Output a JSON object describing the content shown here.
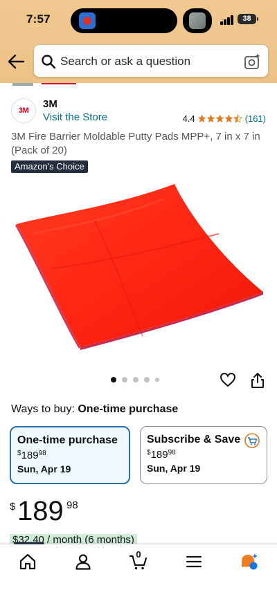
{
  "status_bar": {
    "time": "7:57",
    "battery": "38"
  },
  "search": {
    "placeholder": "Search or ask a question"
  },
  "brand": {
    "logo": "3M",
    "name": "3M",
    "visit_store": "Visit the Store"
  },
  "rating": {
    "value": "4.4",
    "stars": 4.4,
    "count": "(161)"
  },
  "product": {
    "title": "3M Fire Barrier Moldable Putty Pads MPP+, 7 in x 7 in (Pack of 20)",
    "badge": "Amazon's Choice",
    "image_icon": "red-putty-pad-image",
    "image_color": "#ff2a12"
  },
  "carousel": {
    "total": 5,
    "active": 1
  },
  "ways_to_buy": {
    "label": "Ways to buy:",
    "value": "One-time purchase"
  },
  "options": [
    {
      "title": "One-time purchase",
      "currency": "$",
      "whole": "189",
      "fraction": "98",
      "date": "Sun, Apr 19",
      "selected": true
    },
    {
      "title": "Subscribe & Save",
      "currency": "$",
      "whole": "189",
      "fraction": "98",
      "date": "Sun, Apr 19",
      "selected": false
    }
  ],
  "price": {
    "currency": "$",
    "whole": "189",
    "fraction": "98"
  },
  "peek": {
    "text": "$32.40 / month (6 months)"
  },
  "nav": {
    "items": [
      "home-icon",
      "account-icon",
      "cart-icon",
      "menu-icon",
      "rufus-icon"
    ],
    "cart_count": "0"
  },
  "colors": {
    "header_bg": "#eec58c",
    "link": "#007185",
    "star": "#de7921",
    "selected_border": "#2a6fa8",
    "selected_bg": "#edf8ff",
    "badge_bg": "#232f3e"
  }
}
